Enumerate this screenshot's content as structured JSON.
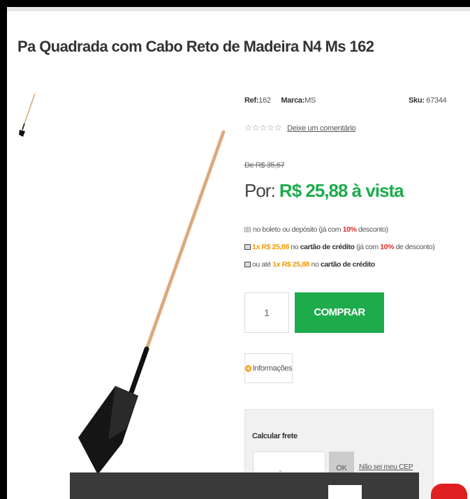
{
  "product": {
    "title": "Pa Quadrada com Cabo Reto de Madeira N4 Ms 162",
    "ref_label": "Ref:",
    "ref_value": "162",
    "brand_label": "Marca:",
    "brand_value": "MS",
    "sku_label": "Sku:",
    "sku_value": "67344",
    "rating_stars": 0,
    "stars_text": "☆☆☆☆☆",
    "comment_link": "Deixe um comentário",
    "old_price": "De R$ 35,67",
    "price_prefix": "Por:",
    "price_value": "R$ 25,88 à vista"
  },
  "payment": {
    "boleto": {
      "text": "no boleto ou depósito (já com ",
      "discount": "10%",
      "suffix": " desconto)"
    },
    "credit1": {
      "installment": "1x R$ 25,88",
      "mid": " no ",
      "method": "cartão de crédito",
      "paren": " (já com ",
      "discount": "10%",
      "suffix": " de desconto)"
    },
    "credit2": {
      "prefix": "ou até ",
      "installment": "1x R$ 25,88",
      "mid": " no ",
      "method": "cartão de crédito"
    }
  },
  "purchase": {
    "quantity": "1",
    "buy_label": "COMPRAR",
    "info_label": "Informações"
  },
  "shipping": {
    "title": "Calcular frete",
    "cep_placeholder": "_____-___",
    "ok_label": "OK",
    "unknown_cep_link": "Não sei meu CEP"
  },
  "colors": {
    "accent_green": "#1eab4c",
    "discount_red": "#e32b2b",
    "installment_orange": "#f59a00"
  }
}
